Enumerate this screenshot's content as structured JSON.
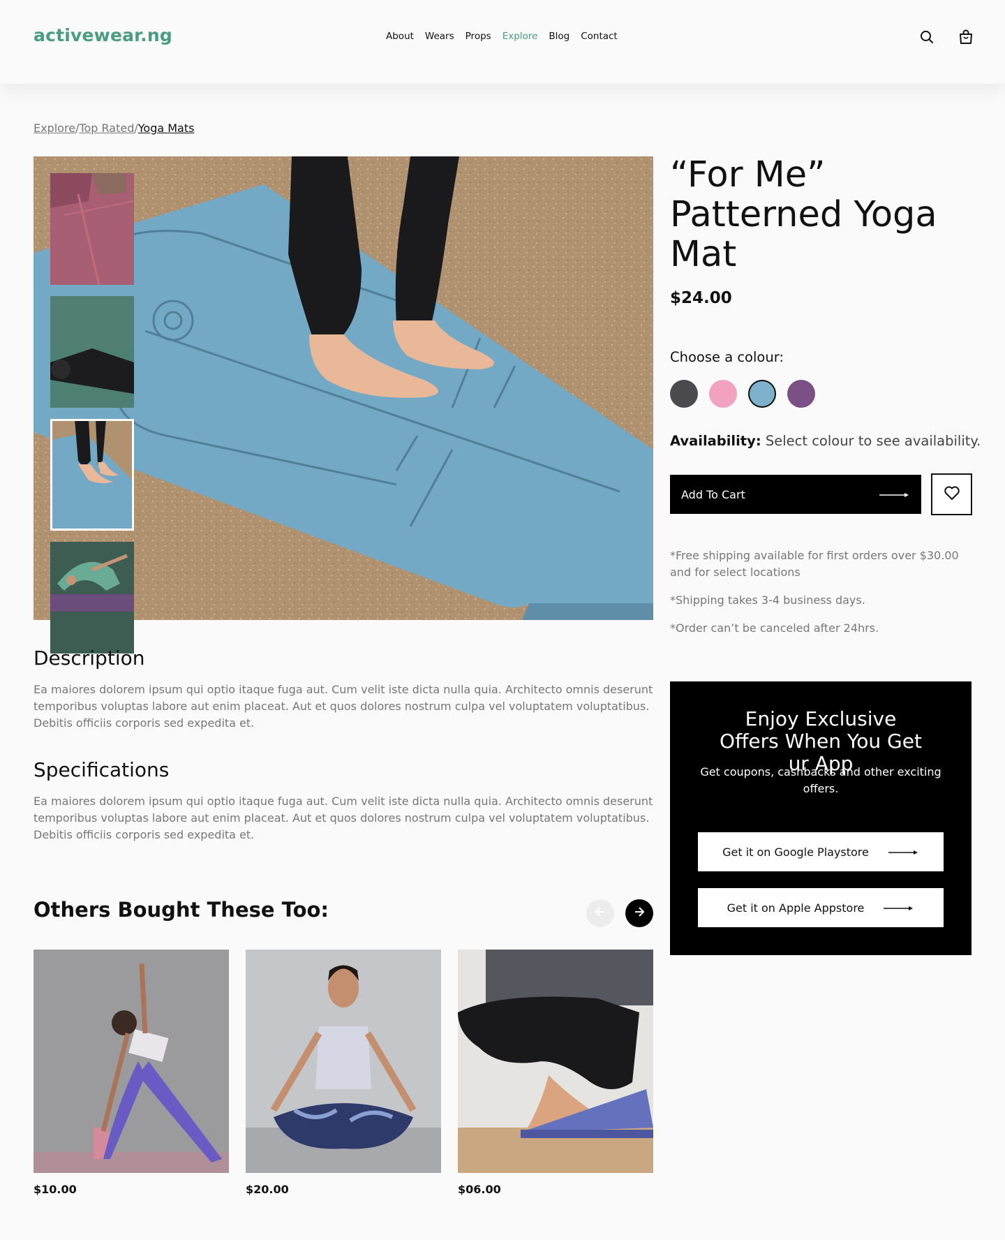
{
  "brand": {
    "logo": "activewear.ng",
    "accent_color": "#4a9d80"
  },
  "nav": {
    "items": [
      {
        "label": "About"
      },
      {
        "label": "Wears"
      },
      {
        "label": "Props"
      },
      {
        "label": "Explore",
        "active": true
      },
      {
        "label": "Blog"
      },
      {
        "label": "Contact"
      }
    ],
    "icons": [
      "search-icon",
      "shopping-bag-icon"
    ]
  },
  "breadcrumb": {
    "items": [
      "Explore",
      "Top Rated",
      "Yoga Mats"
    ],
    "separator": "/"
  },
  "product": {
    "title": "“For Me” Patterned Yoga Mat",
    "price": "$24.00",
    "colour_label": "Choose a colour:",
    "colours": [
      {
        "name": "dark grey",
        "hex": "#4a4a4f"
      },
      {
        "name": "pink",
        "hex": "#f2a2bf"
      },
      {
        "name": "blue",
        "hex": "#7eb1cb",
        "selected": true
      },
      {
        "name": "purple",
        "hex": "#7b5084"
      }
    ],
    "availability_label": "Availability:",
    "availability_text": "Select colour to see availability.",
    "add_to_cart": "Add To Cart",
    "shipping_notes": [
      "*Free shipping available for first orders over $30.00 and for select locations",
      "*Shipping takes 3-4 business days.",
      "*Order can’t be canceled after 24hrs."
    ]
  },
  "description": {
    "title": "Description",
    "text": "Ea maiores dolorem ipsum qui optio itaque fuga aut. Cum velit iste dicta nulla quia. Architecto omnis deserunt temporibus voluptas labore aut enim placeat. Aut et quos dolores nostrum culpa vel voluptatem voluptatibus. Debitis officiis corporis sed expedita et."
  },
  "specifications": {
    "title": "Specifications",
    "text": "Ea maiores dolorem ipsum qui optio itaque fuga aut. Cum velit iste dicta nulla quia. Architecto omnis deserunt temporibus voluptas labore aut enim placeat. Aut et quos dolores nostrum culpa vel voluptatem voluptatibus. Debitis officiis corporis sed expedita et."
  },
  "promo": {
    "title": "Enjoy Exclusive Offers When You Get ur App",
    "subtitle": "Get coupons, cashbacks and other exciting offers.",
    "google_button": "Get it on Google Playstore",
    "apple_button": "Get it on Apple Appstore"
  },
  "others": {
    "title": "Others Bought These Too:",
    "items": [
      {
        "price": "$10.00"
      },
      {
        "price": "$20.00"
      },
      {
        "price": "$06.00"
      }
    ]
  }
}
